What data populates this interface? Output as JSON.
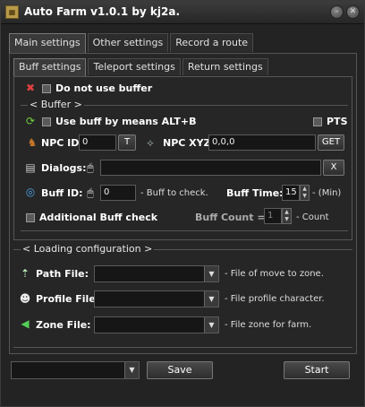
{
  "window": {
    "title": "Auto Farm v1.0.1 by kj2a."
  },
  "tabs_main": [
    "Main settings",
    "Other settings",
    "Record a route"
  ],
  "tabs_sub": [
    "Buff settings",
    "Teleport settings",
    "Return settings"
  ],
  "buff": {
    "do_not_use": "Do not use buffer",
    "group_title": "< Buffer >",
    "use_alt_b": "Use buff by means ALT+B",
    "pts": "PTS",
    "npc_id_label": "NPC ID:",
    "npc_id_value": "0",
    "t_button": "T",
    "npc_xyz_label": "NPC XYZ:",
    "npc_xyz_value": "0,0,0",
    "get_button": "GET",
    "dialogs_label": "Dialogs:",
    "dialogs_value": "",
    "x_button": "X",
    "buff_id_label": "Buff ID:",
    "buff_id_value": "0",
    "buff_id_hint": "- Buff to check.",
    "buff_time_label": "Buff Time:",
    "buff_time_value": "15",
    "buff_time_unit": "- (Min)",
    "additional_check": "Additional Buff check",
    "buff_count_label": "Buff Count =",
    "buff_count_value": "1",
    "buff_count_unit": "- Count"
  },
  "loading": {
    "group_title": "< Loading configuration >",
    "path_label": "Path File:",
    "path_hint": "- File of move to zone.",
    "profile_label": "Profile File:",
    "profile_hint": "- File profile character.",
    "zone_label": "Zone File:",
    "zone_hint": "- File zone for farm."
  },
  "footer": {
    "save": "Save",
    "start": "Start"
  }
}
